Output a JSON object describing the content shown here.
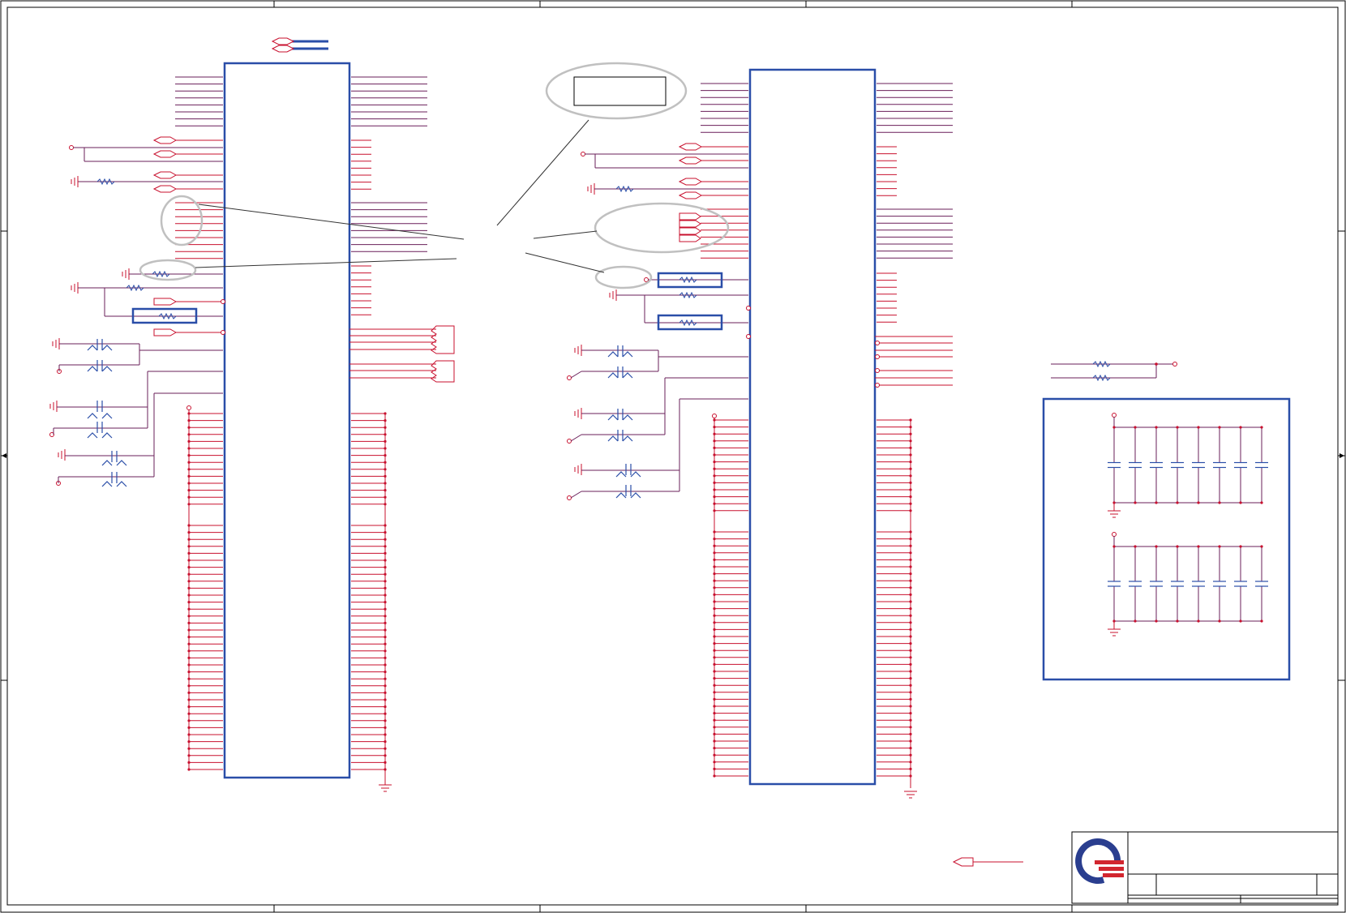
{
  "sheet": {
    "title": "",
    "colors": {
      "wire": "#c8102e",
      "net": "#6a1f5a",
      "component": "#2a4ea8",
      "callout": "#c0c0c0",
      "logo_blue": "#2a3e8f",
      "logo_red": "#d2262f"
    }
  },
  "title_block": {
    "logo_icon": "company-logo-icon"
  }
}
